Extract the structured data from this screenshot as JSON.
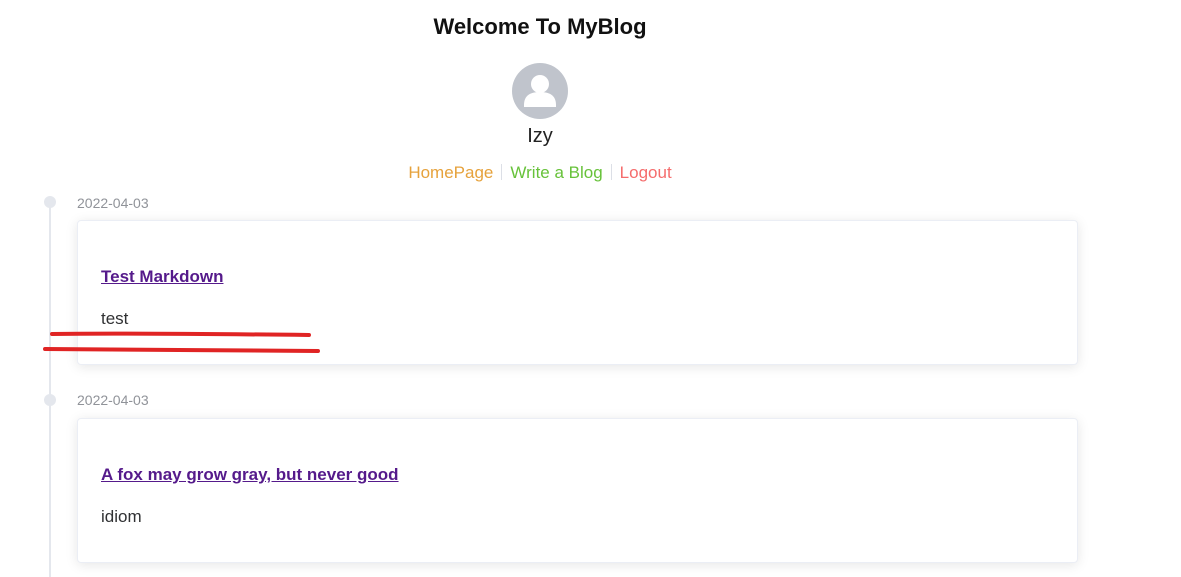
{
  "header": {
    "title": "Welcome To MyBlog"
  },
  "user": {
    "name": "Izy",
    "avatar_icon": "user-avatar-icon"
  },
  "nav": {
    "home_label": "HomePage",
    "write_label": "Write a Blog",
    "logout_label": "Logout"
  },
  "colors": {
    "home": "#e6a23c",
    "write": "#67c23a",
    "logout": "#f56c6c",
    "link_title": "#551a8b",
    "annotation": "#e02424"
  },
  "posts": [
    {
      "date": "2022-04-03",
      "title": "Test Markdown",
      "summary": "test"
    },
    {
      "date": "2022-04-03",
      "title": "A fox may grow gray, but never good",
      "summary": "idiom"
    }
  ]
}
